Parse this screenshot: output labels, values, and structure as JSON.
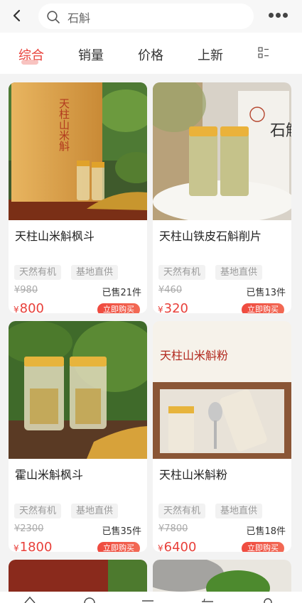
{
  "search": {
    "value": "石斛"
  },
  "tabs": [
    "综合",
    "销量",
    "价格",
    "上新"
  ],
  "accent": "#e8403a",
  "products": [
    {
      "name": "天柱山米斛枫斗",
      "tags": [
        "天然有机",
        "基地直供"
      ],
      "old_price": "¥980",
      "sold": "已售21件",
      "price": "800",
      "buy_label": "立即购买",
      "image_text": "天柱山米斛"
    },
    {
      "name": "天柱山铁皮石斛削片",
      "tags": [
        "天然有机",
        "基地直供"
      ],
      "old_price": "¥460",
      "sold": "已售13件",
      "price": "320",
      "buy_label": "立即购买",
      "image_text": "石斛"
    },
    {
      "name": "霍山米斛枫斗",
      "tags": [
        "天然有机",
        "基地直供"
      ],
      "old_price": "¥2300",
      "sold": "已售35件",
      "price": "1800",
      "buy_label": "立即购买",
      "image_text": ""
    },
    {
      "name": "天柱山米斛粉",
      "tags": [
        "天然有机",
        "基地直供"
      ],
      "old_price": "¥7800",
      "sold": "已售18件",
      "price": "6400",
      "buy_label": "立即购买",
      "image_text": "天柱山米斛粉"
    }
  ],
  "price_symbol": "¥"
}
